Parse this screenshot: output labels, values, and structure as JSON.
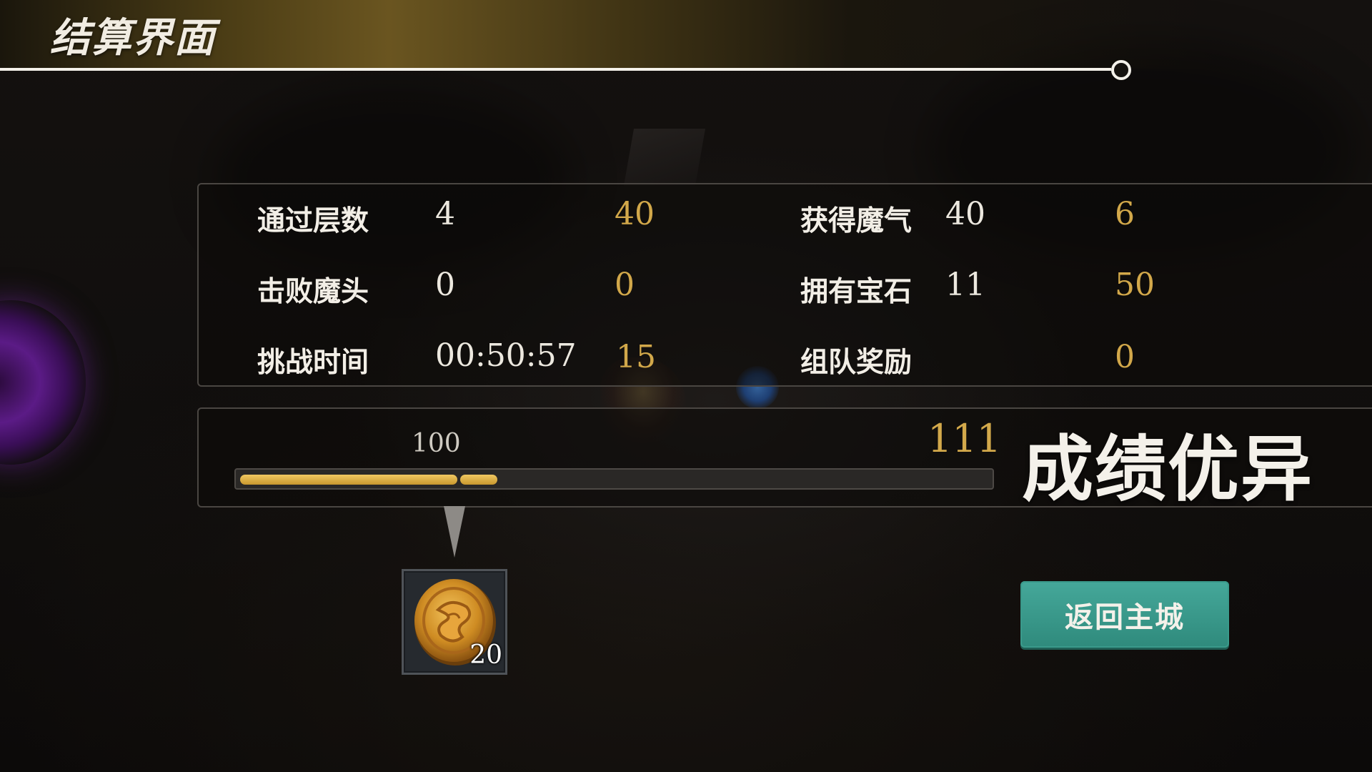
{
  "header": {
    "title": "结算界面"
  },
  "stats": {
    "rows_left": [
      {
        "label": "通过层数",
        "value": "4",
        "score": "40"
      },
      {
        "label": "击败魔头",
        "value": "0",
        "score": "0"
      },
      {
        "label": "挑战时间",
        "value": "00:50:57",
        "score": "15"
      }
    ],
    "rows_right": [
      {
        "label": "获得魔气",
        "value": "40",
        "score": "6"
      },
      {
        "label": "拥有宝石",
        "value": "11",
        "score": "50"
      },
      {
        "label": "组队奖励",
        "value": "",
        "score": "0"
      }
    ]
  },
  "progress": {
    "tick_label": "100",
    "total_score": "111",
    "fill_segments_fraction": [
      0.29,
      0.05
    ],
    "rating": "成绩优异"
  },
  "reward": {
    "icon": "gold-coin-icon",
    "count": "20"
  },
  "actions": {
    "return_label": "返回主城",
    "button_color": "#3a9a8b"
  },
  "colors": {
    "score_gold": "#d2a84a",
    "text_light": "#f2eee6"
  }
}
